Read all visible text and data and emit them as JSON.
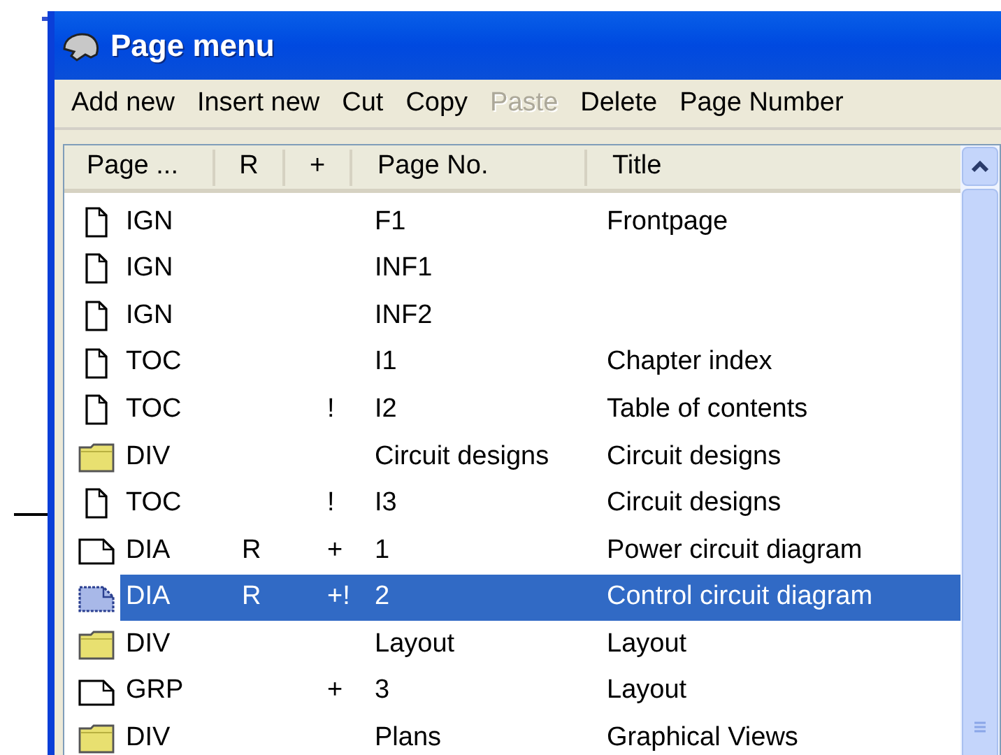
{
  "window": {
    "title": "Page menu"
  },
  "menu": [
    {
      "label": "Add new",
      "disabled": false
    },
    {
      "label": "Insert new",
      "disabled": false
    },
    {
      "label": "Cut",
      "disabled": false
    },
    {
      "label": "Copy",
      "disabled": false
    },
    {
      "label": "Paste",
      "disabled": true
    },
    {
      "label": "Delete",
      "disabled": false
    },
    {
      "label": "Page Number",
      "disabled": false
    }
  ],
  "table": {
    "columns": [
      "Page ...",
      "R",
      "+",
      "Page No.",
      "Title"
    ],
    "rows": [
      {
        "kind": "page",
        "type": "IGN",
        "r": "",
        "plus": "",
        "page_no": "F1",
        "title": "Frontpage",
        "selected": false
      },
      {
        "kind": "page",
        "type": "IGN",
        "r": "",
        "plus": "",
        "page_no": "INF1",
        "title": "",
        "selected": false
      },
      {
        "kind": "page",
        "type": "IGN",
        "r": "",
        "plus": "",
        "page_no": "INF2",
        "title": "",
        "selected": false
      },
      {
        "kind": "page",
        "type": "TOC",
        "r": "",
        "plus": "",
        "page_no": "I1",
        "title": "Chapter index",
        "selected": false
      },
      {
        "kind": "page",
        "type": "TOC",
        "r": "",
        "plus": "!",
        "page_no": "I2",
        "title": "Table of contents",
        "selected": false
      },
      {
        "kind": "folder",
        "type": "DIV",
        "r": "",
        "plus": "",
        "page_no": "Circuit designs",
        "title": "Circuit designs",
        "selected": false
      },
      {
        "kind": "page",
        "type": "TOC",
        "r": "",
        "plus": "!",
        "page_no": "I3",
        "title": "Circuit designs",
        "selected": false
      },
      {
        "kind": "sheet",
        "type": "DIA",
        "r": "R",
        "plus": "+",
        "page_no": "1",
        "title": "Power circuit diagram",
        "selected": false
      },
      {
        "kind": "sheet",
        "type": "DIA",
        "r": "R",
        "plus": "+!",
        "page_no": "2",
        "title": "Control circuit diagram",
        "selected": true
      },
      {
        "kind": "folder",
        "type": "DIV",
        "r": "",
        "plus": "",
        "page_no": "Layout",
        "title": "Layout",
        "selected": false
      },
      {
        "kind": "sheet",
        "type": "GRP",
        "r": "",
        "plus": "+",
        "page_no": "3",
        "title": "Layout",
        "selected": false
      },
      {
        "kind": "folder",
        "type": "DIV",
        "r": "",
        "plus": "",
        "page_no": "Plans",
        "title": "Graphical Views",
        "selected": false
      }
    ]
  }
}
